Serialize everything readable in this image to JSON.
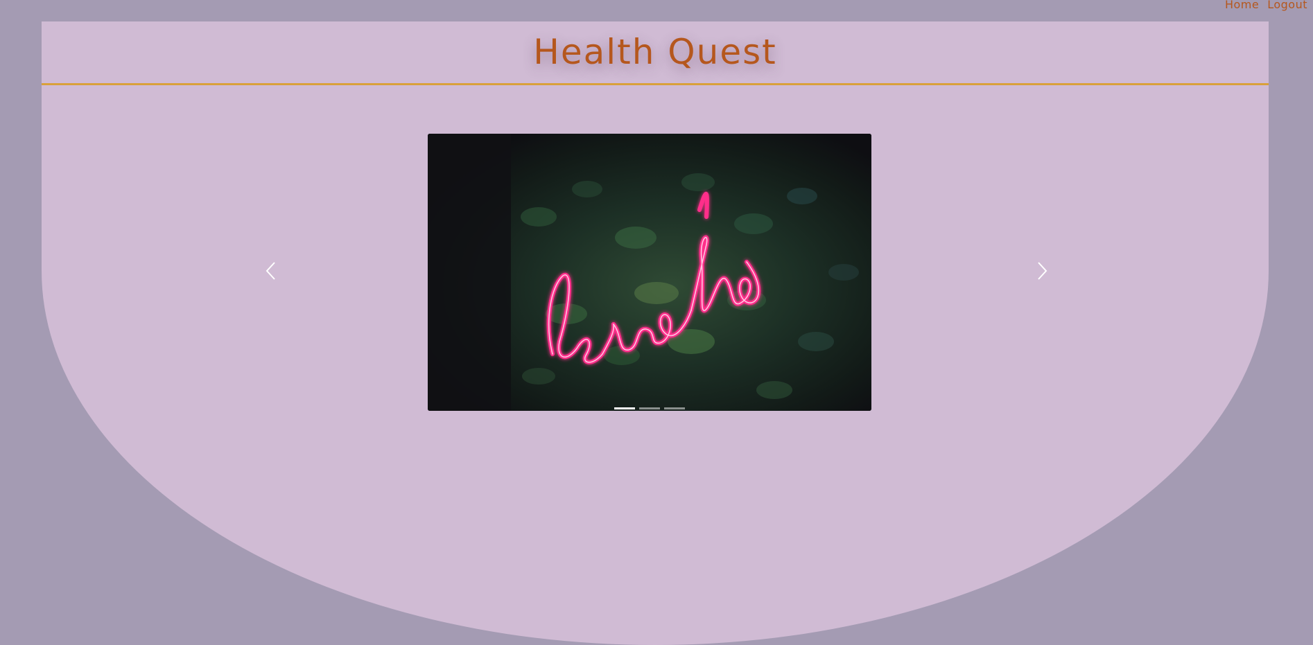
{
  "nav": {
    "home": "Home",
    "logout": "Logout"
  },
  "header": {
    "title": "Health Quest"
  },
  "carousel": {
    "slide_count": 3,
    "active_index": 0,
    "prev_icon": "chevron-left-icon",
    "next_icon": "chevron-right-icon"
  },
  "colors": {
    "page_background": "#a49bb3",
    "card_background": "#d0bbd4",
    "accent_text": "#b5571d",
    "header_rule": "#d9a03a",
    "neon_sign": "#ff2d8a"
  }
}
